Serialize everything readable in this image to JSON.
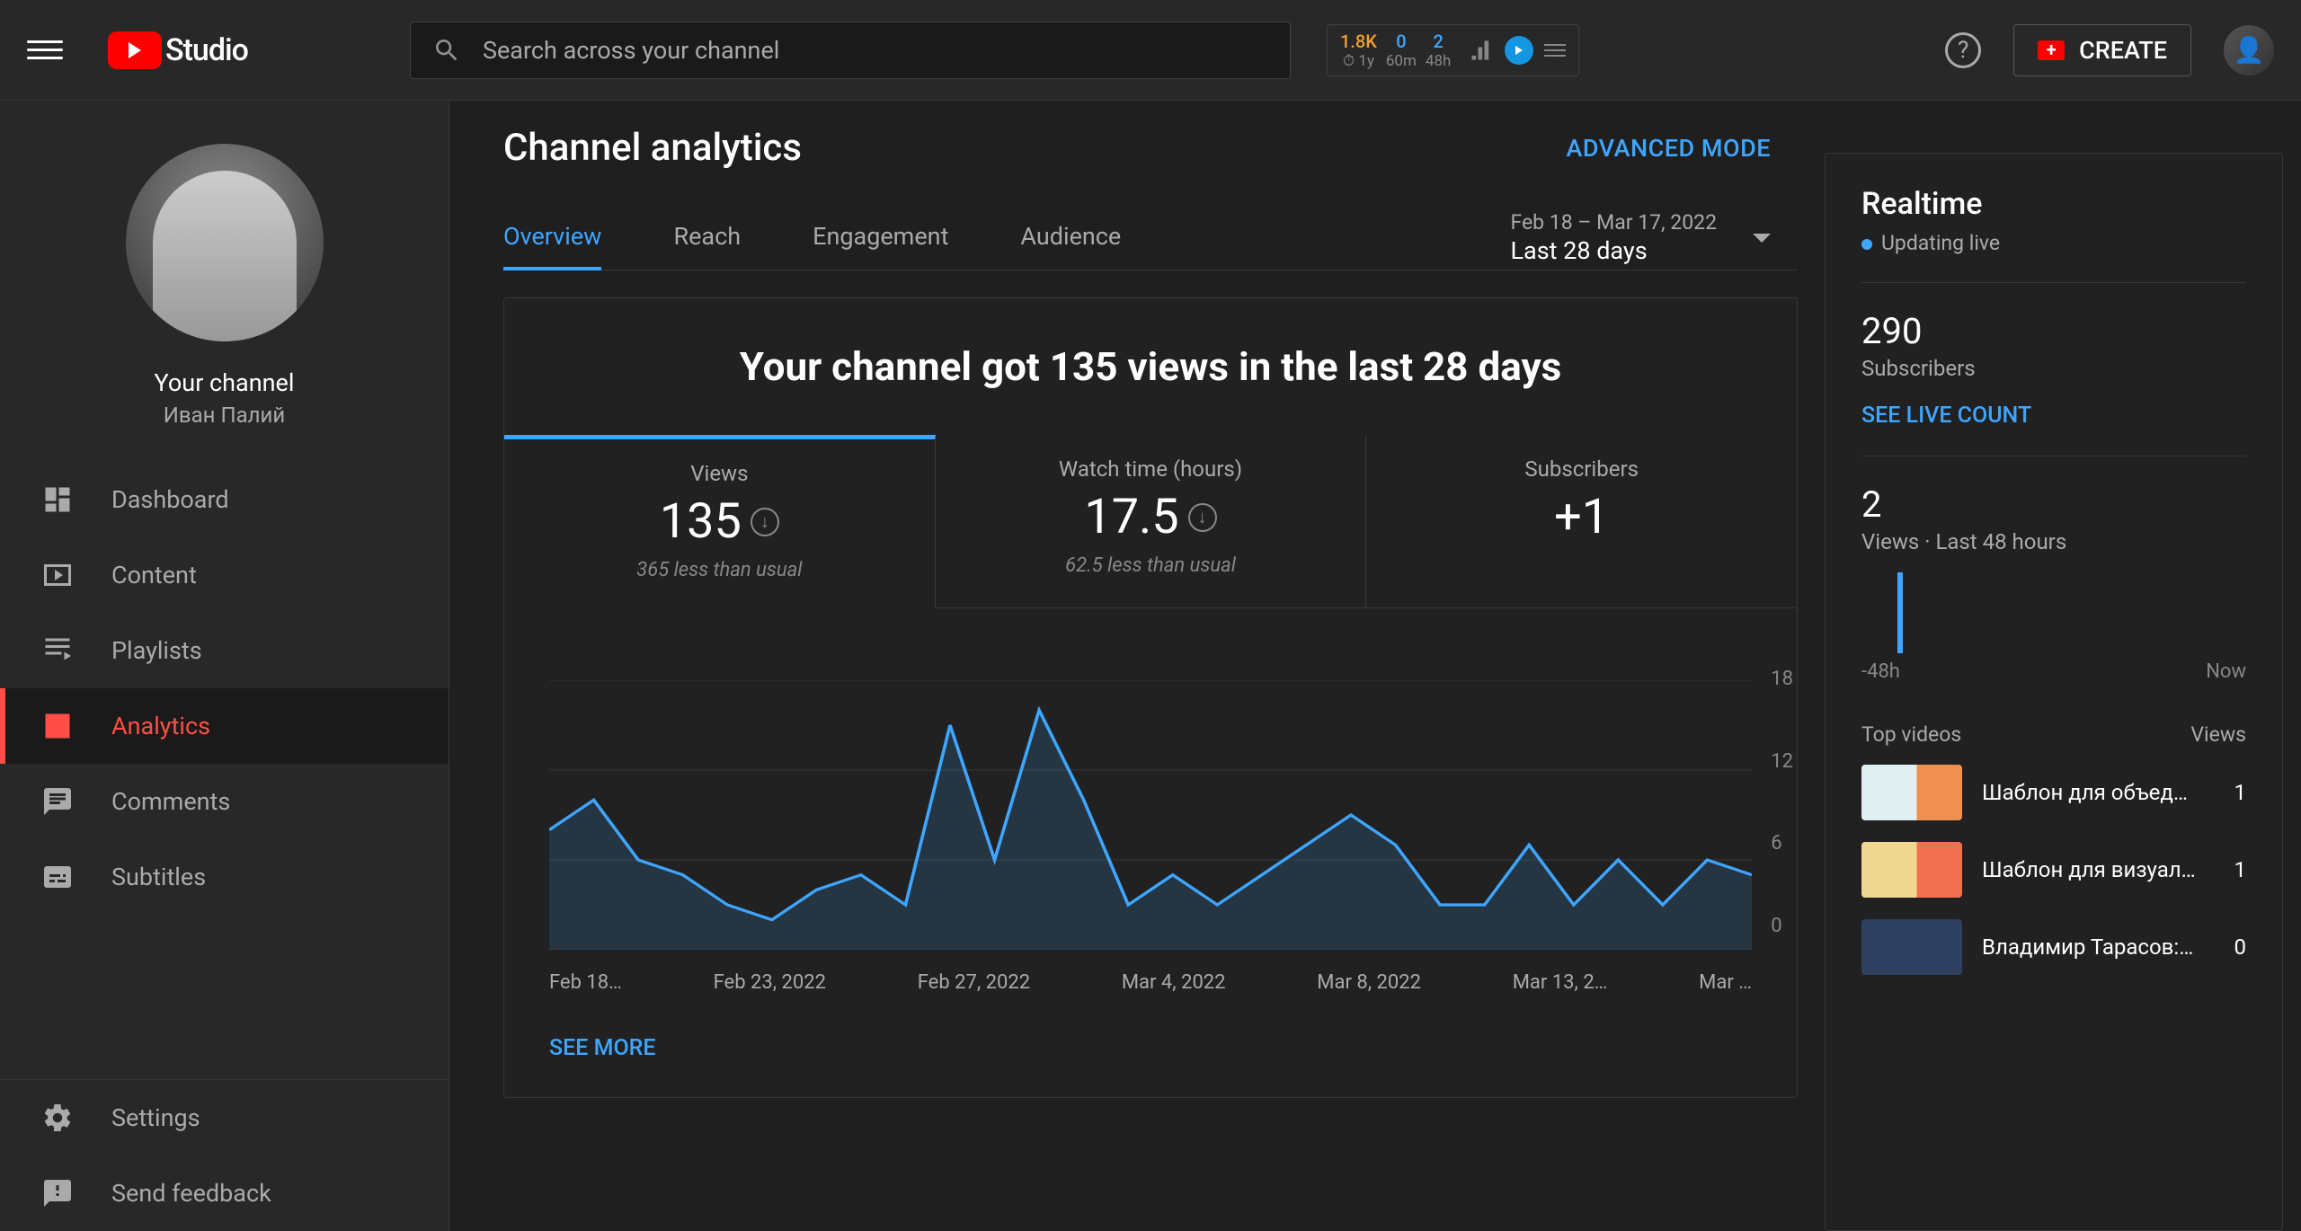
{
  "header": {
    "logo_text": "Studio",
    "search_placeholder": "Search across your channel",
    "badges": [
      {
        "value": "1.8K",
        "sub": "1y",
        "color": "orange",
        "subicon": "clock"
      },
      {
        "value": "0",
        "sub": "60m",
        "color": "blue"
      },
      {
        "value": "2",
        "sub": "48h",
        "color": "blue"
      }
    ],
    "create_label": "CREATE"
  },
  "sidebar": {
    "profile_title": "Your channel",
    "profile_name": "Иван Палий",
    "items": [
      {
        "icon": "dashboard",
        "label": "Dashboard"
      },
      {
        "icon": "content",
        "label": "Content"
      },
      {
        "icon": "playlist",
        "label": "Playlists"
      },
      {
        "icon": "analytics",
        "label": "Analytics",
        "active": true
      },
      {
        "icon": "comments",
        "label": "Comments"
      },
      {
        "icon": "subtitles",
        "label": "Subtitles"
      }
    ],
    "bottom": [
      {
        "icon": "settings",
        "label": "Settings"
      },
      {
        "icon": "feedback",
        "label": "Send feedback"
      }
    ]
  },
  "page": {
    "title": "Channel analytics",
    "advanced_mode": "ADVANCED MODE",
    "tabs": [
      "Overview",
      "Reach",
      "Engagement",
      "Audience"
    ],
    "active_tab": 0,
    "date_line1": "Feb 18 – Mar 17, 2022",
    "date_line2": "Last 28 days",
    "headline": "Your channel got 135 views in the last 28 days",
    "stats": [
      {
        "label": "Views",
        "value": "135",
        "down": true,
        "sub": "365 less than usual"
      },
      {
        "label": "Watch time (hours)",
        "value": "17.5",
        "down": true,
        "sub": "62.5 less than usual"
      },
      {
        "label": "Subscribers",
        "value": "+1",
        "down": false,
        "sub": ""
      }
    ],
    "see_more": "SEE MORE"
  },
  "chart_data": {
    "type": "area",
    "xlabel": "",
    "ylabel": "",
    "ylim": [
      0,
      18
    ],
    "y_ticks": [
      18,
      12,
      6,
      0
    ],
    "x_ticks": [
      "Feb 18…",
      "Feb 23, 2022",
      "Feb 27, 2022",
      "Mar 4, 2022",
      "Mar 8, 2022",
      "Mar 13, 2…",
      "Mar …"
    ],
    "series": [
      {
        "name": "Views",
        "values": [
          8,
          10,
          6,
          5,
          3,
          2,
          4,
          5,
          3,
          15,
          6,
          16,
          10,
          3,
          5,
          3,
          5,
          7,
          9,
          7,
          3,
          3,
          7,
          3,
          6,
          3,
          6,
          5
        ]
      }
    ]
  },
  "realtime": {
    "title": "Realtime",
    "updating": "Updating live",
    "subscribers_value": "290",
    "subscribers_label": "Subscribers",
    "see_live": "SEE LIVE COUNT",
    "views48_value": "2",
    "views48_label": "Views · Last 48 hours",
    "bar_data": [
      0,
      0,
      0,
      0,
      0,
      60,
      0,
      0,
      0,
      0,
      0,
      0,
      0,
      0,
      0,
      0,
      0,
      0,
      0,
      0,
      0,
      0,
      0,
      0
    ],
    "axis_left": "-48h",
    "axis_right": "Now",
    "top_videos_label": "Top videos",
    "views_label": "Views",
    "items": [
      {
        "title": "Шаблон для объед…",
        "count": "1"
      },
      {
        "title": "Шаблон для визуал…",
        "count": "1"
      },
      {
        "title": "Владимир Тарасов:…",
        "count": "0"
      }
    ]
  }
}
